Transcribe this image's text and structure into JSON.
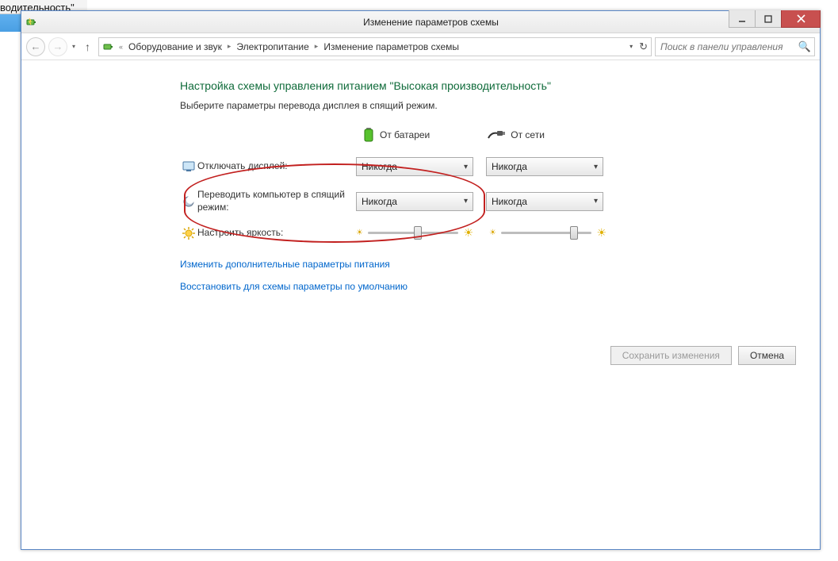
{
  "bg": {
    "fragment_text": "водительность\""
  },
  "window": {
    "title": "Изменение параметров схемы"
  },
  "nav": {
    "breadcrumb": {
      "prefix": "«",
      "items": [
        "Оборудование и звук",
        "Электропитание",
        "Изменение параметров схемы"
      ]
    },
    "search_placeholder": "Поиск в панели управления"
  },
  "page": {
    "heading": "Настройка схемы управления питанием \"Высокая производительность\"",
    "subtext": "Выберите параметры перевода дисплея в спящий режим.",
    "col_battery": "От батареи",
    "col_ac": "От сети",
    "settings": {
      "display_off": {
        "label": "Отключать дисплей:",
        "battery": "Никогда",
        "ac": "Никогда"
      },
      "sleep": {
        "label": "Переводить компьютер в спящий режим:",
        "battery": "Никогда",
        "ac": "Никогда"
      },
      "brightness": {
        "label": "Настроить яркость:"
      }
    },
    "link_advanced": "Изменить дополнительные параметры питания",
    "link_restore": "Восстановить для схемы параметры по умолчанию",
    "save_button": "Сохранить изменения",
    "cancel_button": "Отмена"
  }
}
